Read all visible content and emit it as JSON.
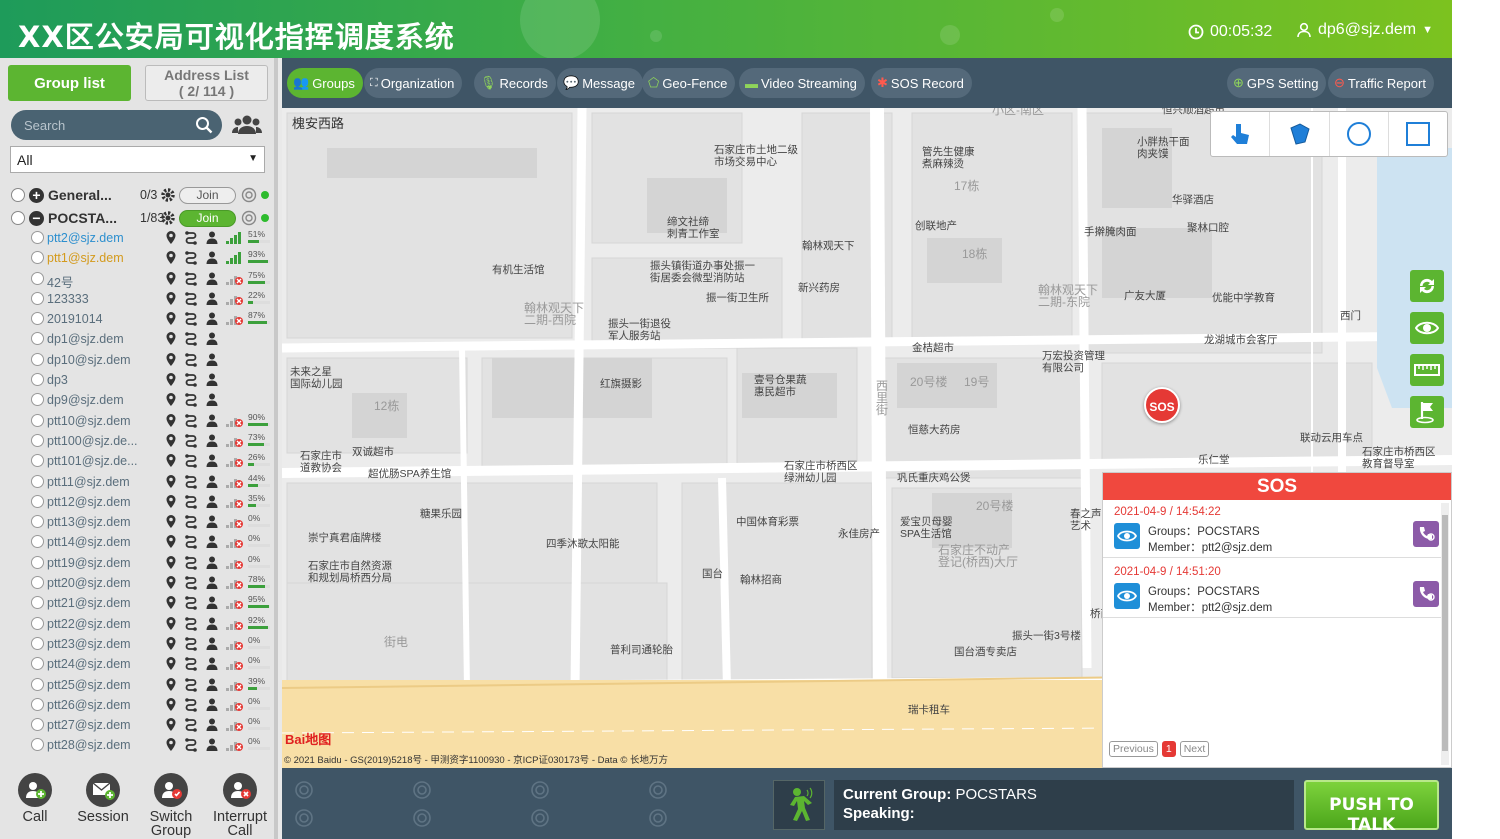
{
  "header": {
    "title": "XX区公安局可视化指挥调度系统",
    "timer": "00:05:32",
    "user": "dp6@sjz.dem",
    "colors": {
      "gradient_start": "#1e9b5a",
      "gradient_end": "#7cc21f"
    }
  },
  "left": {
    "tab_group": "Group list",
    "tab_address_line1": "Address List",
    "tab_address_line2": "( 2/ 114 )",
    "search_placeholder": "Search",
    "filter_value": "All",
    "groups": [
      {
        "name": "General...",
        "count": "0/3",
        "join": "Join",
        "expanded": false
      },
      {
        "name": "POCSTA...",
        "count": "1/83",
        "join": "Join",
        "expanded": true
      }
    ],
    "members": [
      {
        "name": "ptt2@sjz.dem",
        "state": "online",
        "battery": "51%",
        "pct": 51
      },
      {
        "name": "ptt1@sjz.dem",
        "state": "active",
        "battery": "93%",
        "pct": 93
      },
      {
        "name": "42号",
        "state": "offline",
        "battery": "75%",
        "pct": 75
      },
      {
        "name": "123333",
        "state": "offline",
        "battery": "22%",
        "pct": 22
      },
      {
        "name": "20191014",
        "state": "offline",
        "battery": "87%",
        "pct": 87
      },
      {
        "name": "dp1@sjz.dem",
        "state": "none",
        "battery": "",
        "pct": 0
      },
      {
        "name": "dp10@sjz.dem",
        "state": "none",
        "battery": "",
        "pct": 0
      },
      {
        "name": "dp3",
        "state": "none",
        "battery": "",
        "pct": 0
      },
      {
        "name": "dp9@sjz.dem",
        "state": "none",
        "battery": "",
        "pct": 0
      },
      {
        "name": "ptt10@sjz.dem",
        "state": "offline",
        "battery": "90%",
        "pct": 90
      },
      {
        "name": "ptt100@sjz.de...",
        "state": "offline",
        "battery": "73%",
        "pct": 73
      },
      {
        "name": "ptt101@sjz.de...",
        "state": "offline",
        "battery": "26%",
        "pct": 26
      },
      {
        "name": "ptt11@sjz.dem",
        "state": "offline",
        "battery": "44%",
        "pct": 44
      },
      {
        "name": "ptt12@sjz.dem",
        "state": "offline",
        "battery": "35%",
        "pct": 35
      },
      {
        "name": "ptt13@sjz.dem",
        "state": "offline",
        "battery": "0%",
        "pct": 0
      },
      {
        "name": "ptt14@sjz.dem",
        "state": "offline",
        "battery": "0%",
        "pct": 0
      },
      {
        "name": "ptt19@sjz.dem",
        "state": "offline",
        "battery": "0%",
        "pct": 0
      },
      {
        "name": "ptt20@sjz.dem",
        "state": "offline",
        "battery": "78%",
        "pct": 78
      },
      {
        "name": "ptt21@sjz.dem",
        "state": "offline",
        "battery": "95%",
        "pct": 95
      },
      {
        "name": "ptt22@sjz.dem",
        "state": "offline",
        "battery": "92%",
        "pct": 92
      },
      {
        "name": "ptt23@sjz.dem",
        "state": "offline",
        "battery": "0%",
        "pct": 0
      },
      {
        "name": "ptt24@sjz.dem",
        "state": "offline",
        "battery": "0%",
        "pct": 0
      },
      {
        "name": "ptt25@sjz.dem",
        "state": "offline",
        "battery": "39%",
        "pct": 39
      },
      {
        "name": "ptt26@sjz.dem",
        "state": "offline",
        "battery": "0%",
        "pct": 0
      },
      {
        "name": "ptt27@sjz.dem",
        "state": "offline",
        "battery": "0%",
        "pct": 0
      },
      {
        "name": "ptt28@sjz.dem",
        "state": "offline",
        "battery": "0%",
        "pct": 0
      }
    ],
    "actions": [
      {
        "label": "Call",
        "icon": "add-person-icon"
      },
      {
        "label": "Session",
        "icon": "envelope-add-icon"
      },
      {
        "label": "Switch\nGroup",
        "icon": "switch-group-icon"
      },
      {
        "label": "Interrupt\nCall",
        "icon": "interrupt-call-icon"
      }
    ]
  },
  "toolbar": {
    "items": [
      {
        "label": "Groups",
        "icon": "groups-icon",
        "active": true
      },
      {
        "label": "Organization",
        "icon": "org-icon"
      },
      {
        "label": "Records",
        "icon": "mic-icon"
      },
      {
        "label": "Message",
        "icon": "message-icon"
      },
      {
        "label": "Geo-Fence",
        "icon": "geofence-icon"
      },
      {
        "label": "Video Streaming",
        "icon": "video-icon"
      },
      {
        "label": "SOS Record",
        "icon": "sos-icon"
      }
    ],
    "right_items": [
      {
        "label": "GPS Setting",
        "icon": "gps-icon"
      },
      {
        "label": "Traffic Report",
        "icon": "traffic-icon"
      }
    ]
  },
  "map": {
    "pois": [
      "小区-南区",
      "恒兴顺酒超市",
      "石家庄市土地二级\n市场交易中心",
      "管先生健康\n煮麻辣烫",
      "17栋",
      "小胖热干面\n肉夹馍",
      "华驿酒店",
      "缔文社缔\n刺青工作室",
      "翰林观天下",
      "创联地产",
      "手擀腌肉面",
      "聚林口腔",
      "有机生活馆",
      "振头镇街道办事处振一\n街居委会微型消防站",
      "18栋",
      "新兴药房",
      "振一街卫生所",
      "翰林观天下\n二期-西院",
      "振头一街退役\n军人服务站",
      "翰林观天下\n二期-东院",
      "广友大厦",
      "优能中学教育",
      "西门",
      "金桔超市",
      "万宏投资管理\n有限公司",
      "龙湖城市会客厅",
      "未来之星\n国际幼儿园",
      "红旗摄影",
      "壹号仓果蔬\n惠民超市",
      "西\n里\n街",
      "20号楼",
      "19号",
      "12栋",
      "恒慈大药房",
      "联动云用车点",
      "石家庄市\n道教协会",
      "双诚超市",
      "石家庄市桥西区\n绿洲幼儿园",
      "巩氏重庆鸡公煲",
      "乐仁堂",
      "石家庄市桥西区\n教育督导室",
      "超优肠SPA养生馆",
      "糖果乐园",
      "20号楼",
      "崇宁真君庙牌楼",
      "中国体育彩票",
      "永佳房产",
      "爱宝贝母婴\nSPA生活馆",
      "石家庄不动产\n登记(桥西)大厅",
      "春之声\n艺术",
      "四季沐歌太阳能",
      "国台",
      "石家庄市自然资源\n和规划局桥西分局",
      "翰林招商",
      "桥西口腔诊所",
      "街电",
      "振头一街3号楼",
      "普利司通轮胎",
      "国台酒专卖店",
      "瑞卡租车",
      "槐安西路"
    ],
    "sos_marker": "SOS",
    "baidu_logo": "Bai地图",
    "copyright": "© 2021 Baidu - GS(2019)5218号 - 甲测资字1100930 - 京ICP证030173号 - Data © 长地万方"
  },
  "sos": {
    "title": "SOS",
    "items": [
      {
        "time": "2021-04-9 / 14:54:22",
        "group_label": "Groups：",
        "group": "POCSTARS",
        "member_label": "Member：",
        "member": "ptt2@sjz.dem"
      },
      {
        "time": "2021-04-9 / 14:51:20",
        "group_label": "Groups：",
        "group": "POCSTARS",
        "member_label": "Member：",
        "member": "ptt2@sjz.dem"
      }
    ],
    "pager": {
      "prev": "Previous",
      "page": "1",
      "next": "Next"
    }
  },
  "bottom": {
    "current_group_label": "Current Group:",
    "current_group": "POCSTARS",
    "speaking_label": "Speaking:",
    "speaking": "",
    "ptt_label": "PUSH TO TALK",
    "ptt_dots": "• • • •"
  }
}
